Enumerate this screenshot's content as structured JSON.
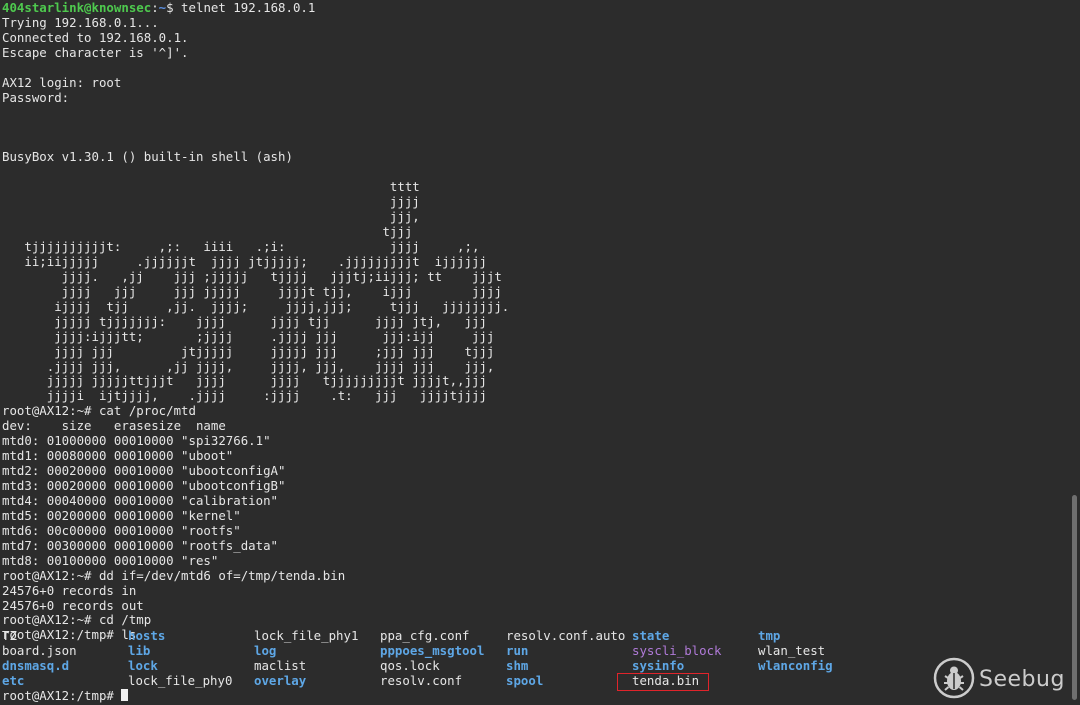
{
  "session": {
    "telnet_user": "404starlink@knownsec",
    "telnet_path": "~",
    "telnet_cmd": "$ telnet 192.168.0.1",
    "output": [
      "Trying 192.168.0.1...",
      "Connected to 192.168.0.1.",
      "Escape character is '^]'.",
      "",
      "AX12 login: root",
      "Password:",
      "",
      "",
      "",
      "BusyBox v1.30.1 () built-in shell (ash)",
      "",
      "                                                    tttt",
      "                                                    jjjj",
      "                                                    jjj,",
      "                                                   tjjj",
      "   tjjjjjjjjjjt:     ,;:   iiii   .;i:              jjjj     ,;,",
      "   ii;iijjjjj     .jjjjjjt  jjjj jtjjjjj;    .jjjjjjjjjt  ijjjjjj",
      "        jjjj.   ,jj    jjj ;jjjjj   tjjjj   jjjtj;iijjj; tt    jjjt",
      "        jjjj   jjj     jjj jjjjj     jjjjt tjj,    ijjj        jjjj",
      "       ijjjj  tjj     ,jj.  jjjj;     jjjj,jjj;     tjjj   jjjjjjjj.",
      "       jjjjj tjjjjjjj:    jjjj      jjjj tjj      jjjj jtj,   jjj",
      "       jjjj:ijjjtt;       ;jjjj     .jjjj jjj      jjj:ijj     jjj",
      "       jjjj jjj         jtjjjjj     jjjjj jjj     ;jjj jjj    tjjj",
      "      .jjjj jjj,      ,jj jjjj,     jjjj, jjj,    jjjj jjj    jjj,",
      "      jjjjj jjjjjttjjjt   jjjj      jjjj   tjjjjjjjjjt jjjjt,,jjj",
      "      jjjji  ijtjjjj,    .jjjj     :jjjj    .t:   jjj   jjjjtjjjj",
      "root@AX12:~# cat /proc/mtd",
      "dev:    size   erasesize  name",
      "mtd0: 01000000 00010000 \"spi32766.1\"",
      "mtd1: 00080000 00010000 \"uboot\"",
      "mtd2: 00020000 00010000 \"ubootconfigA\"",
      "mtd3: 00020000 00010000 \"ubootconfigB\"",
      "mtd4: 00040000 00010000 \"calibration\"",
      "mtd5: 00200000 00010000 \"kernel\"",
      "mtd6: 00c00000 00010000 \"rootfs\"",
      "mtd7: 00300000 00010000 \"rootfs_data\"",
      "mtd8: 00100000 00010000 \"res\"",
      "root@AX12:~# dd if=/dev/mtd6 of=/tmp/tenda.bin",
      "24576+0 records in",
      "24576+0 records out",
      "root@AX12:~# cd /tmp",
      "root@AX12:/tmp# ls"
    ],
    "ls_entries": [
      {
        "name": "TZ",
        "type": "plain"
      },
      {
        "name": "hosts",
        "type": "link"
      },
      {
        "name": "lock_file_phy1",
        "type": "plain"
      },
      {
        "name": "ppa_cfg.conf",
        "type": "plain"
      },
      {
        "name": "resolv.conf.auto",
        "type": "plain"
      },
      {
        "name": "state",
        "type": "dir"
      },
      {
        "name": "tmp",
        "type": "dir"
      },
      {
        "name": "board.json",
        "type": "plain"
      },
      {
        "name": "lib",
        "type": "dir"
      },
      {
        "name": "log",
        "type": "dir"
      },
      {
        "name": "pppoes_msgtool",
        "type": "dir"
      },
      {
        "name": "run",
        "type": "dir"
      },
      {
        "name": "syscli_block",
        "type": "special"
      },
      {
        "name": "wlan_test",
        "type": "plain"
      },
      {
        "name": "dnsmasq.d",
        "type": "dir"
      },
      {
        "name": "lock",
        "type": "dir"
      },
      {
        "name": "maclist",
        "type": "plain"
      },
      {
        "name": "qos.lock",
        "type": "plain"
      },
      {
        "name": "shm",
        "type": "dir"
      },
      {
        "name": "sysinfo",
        "type": "dir"
      },
      {
        "name": "wlanconfig",
        "type": "dir"
      },
      {
        "name": "etc",
        "type": "dir"
      },
      {
        "name": "lock_file_phy0",
        "type": "plain"
      },
      {
        "name": "overlay",
        "type": "dir"
      },
      {
        "name": "resolv.conf",
        "type": "plain"
      },
      {
        "name": "spool",
        "type": "dir"
      },
      {
        "name": "tenda.bin",
        "type": "plain"
      }
    ],
    "final_prompt": "root@AX12:/tmp# "
  },
  "watermark": {
    "text": "Seebug",
    "icon": "seebug-bug-icon"
  },
  "colors": {
    "background": "#2c2c2c",
    "foreground": "#e6e6e6",
    "prompt_user": "#4ec94e",
    "prompt_path": "#5b8fe0",
    "directory": "#5ea7e6",
    "special": "#b07ad8",
    "highlight_box": "#e0242b"
  }
}
